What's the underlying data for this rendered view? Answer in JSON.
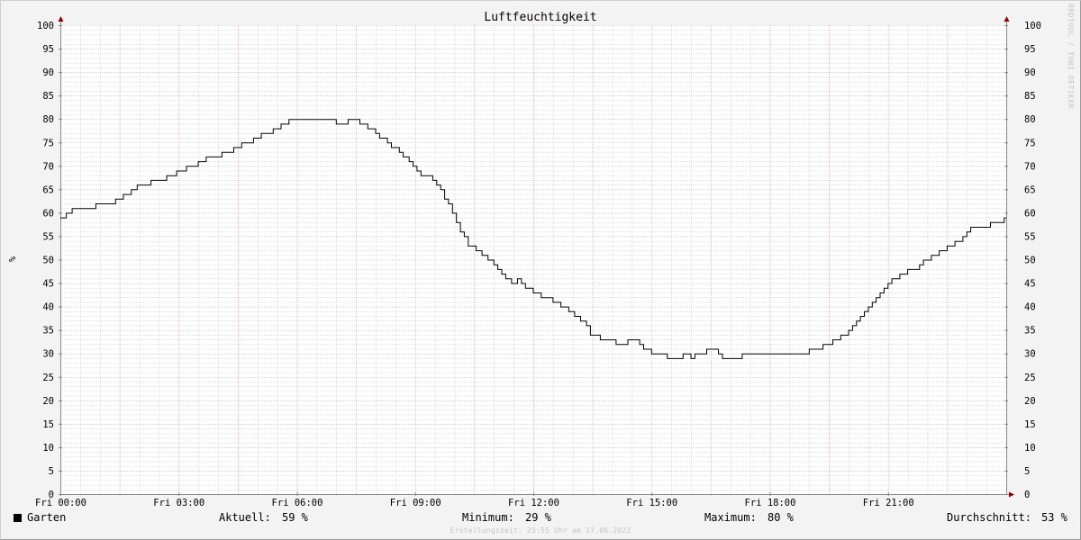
{
  "chart_data": {
    "type": "line",
    "title": "Luftfeuchtigkeit",
    "ylabel": "%",
    "ylim": [
      0,
      100
    ],
    "y_ticks": [
      0,
      5,
      10,
      15,
      20,
      25,
      30,
      35,
      40,
      45,
      50,
      55,
      60,
      65,
      70,
      75,
      80,
      85,
      90,
      95,
      100
    ],
    "x_range_hours": [
      0,
      24
    ],
    "x_ticks": [
      {
        "hour": 0,
        "label": "Fri 00:00"
      },
      {
        "hour": 3,
        "label": "Fri 03:00"
      },
      {
        "hour": 6,
        "label": "Fri 06:00"
      },
      {
        "hour": 9,
        "label": "Fri 09:00"
      },
      {
        "hour": 12,
        "label": "Fri 12:00"
      },
      {
        "hour": 15,
        "label": "Fri 15:00"
      },
      {
        "hour": 18,
        "label": "Fri 18:00"
      },
      {
        "hour": 21,
        "label": "Fri 21:00"
      }
    ],
    "grid": true,
    "series": [
      {
        "name": "Garten",
        "color": "#000000",
        "x_hours": [
          0.0,
          0.15,
          0.3,
          0.6,
          0.65,
          0.9,
          1.0,
          1.4,
          1.6,
          1.8,
          1.95,
          2.1,
          2.3,
          2.5,
          2.7,
          2.95,
          3.2,
          3.5,
          3.7,
          3.9,
          4.1,
          4.4,
          4.6,
          4.9,
          5.1,
          5.4,
          5.6,
          5.8,
          6.3,
          6.4,
          6.5,
          6.7,
          6.9,
          7.0,
          7.25,
          7.3,
          7.45,
          7.6,
          7.8,
          8.0,
          8.1,
          8.3,
          8.4,
          8.6,
          8.7,
          8.85,
          8.95,
          9.05,
          9.15,
          9.3,
          9.45,
          9.55,
          9.65,
          9.75,
          9.85,
          9.95,
          10.05,
          10.15,
          10.25,
          10.35,
          10.55,
          10.7,
          10.85,
          11.0,
          11.1,
          11.2,
          11.3,
          11.45,
          11.6,
          11.7,
          11.8,
          12.0,
          12.2,
          12.5,
          12.7,
          12.9,
          13.05,
          13.2,
          13.35,
          13.45,
          13.7,
          13.9,
          14.1,
          14.4,
          14.55,
          14.7,
          14.8,
          15.0,
          15.1,
          15.2,
          15.4,
          15.8,
          16.0,
          16.1,
          16.3,
          16.4,
          16.7,
          16.8,
          17.0,
          17.1,
          17.3,
          17.5,
          17.7,
          18.0,
          18.5,
          19.0,
          19.1,
          19.35,
          19.6,
          19.8,
          20.0,
          20.1,
          20.2,
          20.3,
          20.4,
          20.5,
          20.6,
          20.7,
          20.8,
          20.9,
          21.0,
          21.1,
          21.3,
          21.5,
          21.8,
          21.9,
          22.1,
          22.3,
          22.5,
          22.7,
          22.9,
          23.0,
          23.1,
          23.3,
          23.6,
          23.95,
          24.0
        ],
        "values": [
          59,
          60,
          61,
          61,
          61,
          62,
          62,
          63,
          64,
          65,
          66,
          66,
          67,
          67,
          68,
          69,
          70,
          71,
          72,
          72,
          73,
          74,
          75,
          76,
          77,
          78,
          79,
          80,
          80,
          80,
          80,
          80,
          80,
          79,
          79,
          80,
          80,
          79,
          78,
          77,
          76,
          75,
          74,
          73,
          72,
          71,
          70,
          69,
          68,
          68,
          67,
          66,
          65,
          63,
          62,
          60,
          58,
          56,
          55,
          53,
          52,
          51,
          50,
          49,
          48,
          47,
          46,
          45,
          46,
          45,
          44,
          43,
          42,
          41,
          40,
          39,
          38,
          37,
          36,
          34,
          33,
          33,
          32,
          33,
          33,
          32,
          31,
          30,
          30,
          30,
          29,
          30,
          29,
          30,
          30,
          31,
          30,
          29,
          29,
          29,
          30,
          30,
          30,
          30,
          30,
          31,
          31,
          32,
          33,
          34,
          35,
          36,
          37,
          38,
          39,
          40,
          41,
          42,
          43,
          44,
          45,
          46,
          47,
          48,
          49,
          50,
          51,
          52,
          53,
          54,
          55,
          56,
          57,
          57,
          58,
          59,
          59
        ]
      }
    ]
  },
  "legend": {
    "series_name": "Garten",
    "current_label": "Aktuell:",
    "current_value": "59 %",
    "min_label": "Minimum:",
    "min_value": "29 %",
    "max_label": "Maximum:",
    "max_value": "80 %",
    "avg_label": "Durchschnitt:",
    "avg_value": "53 %"
  },
  "footer": "Erstellungszeit: 23:55 Uhr am 17.06.2022",
  "watermark": "RRDTOOL / TOBI OETIKER",
  "colors": {
    "background": "#f3f3f3",
    "plot_background": "#ffffff",
    "major_grid": "#e8a0a0",
    "minor_grid": "#cccccc",
    "axis": "#888888",
    "arrow": "#8b0000",
    "line": "#000000"
  }
}
